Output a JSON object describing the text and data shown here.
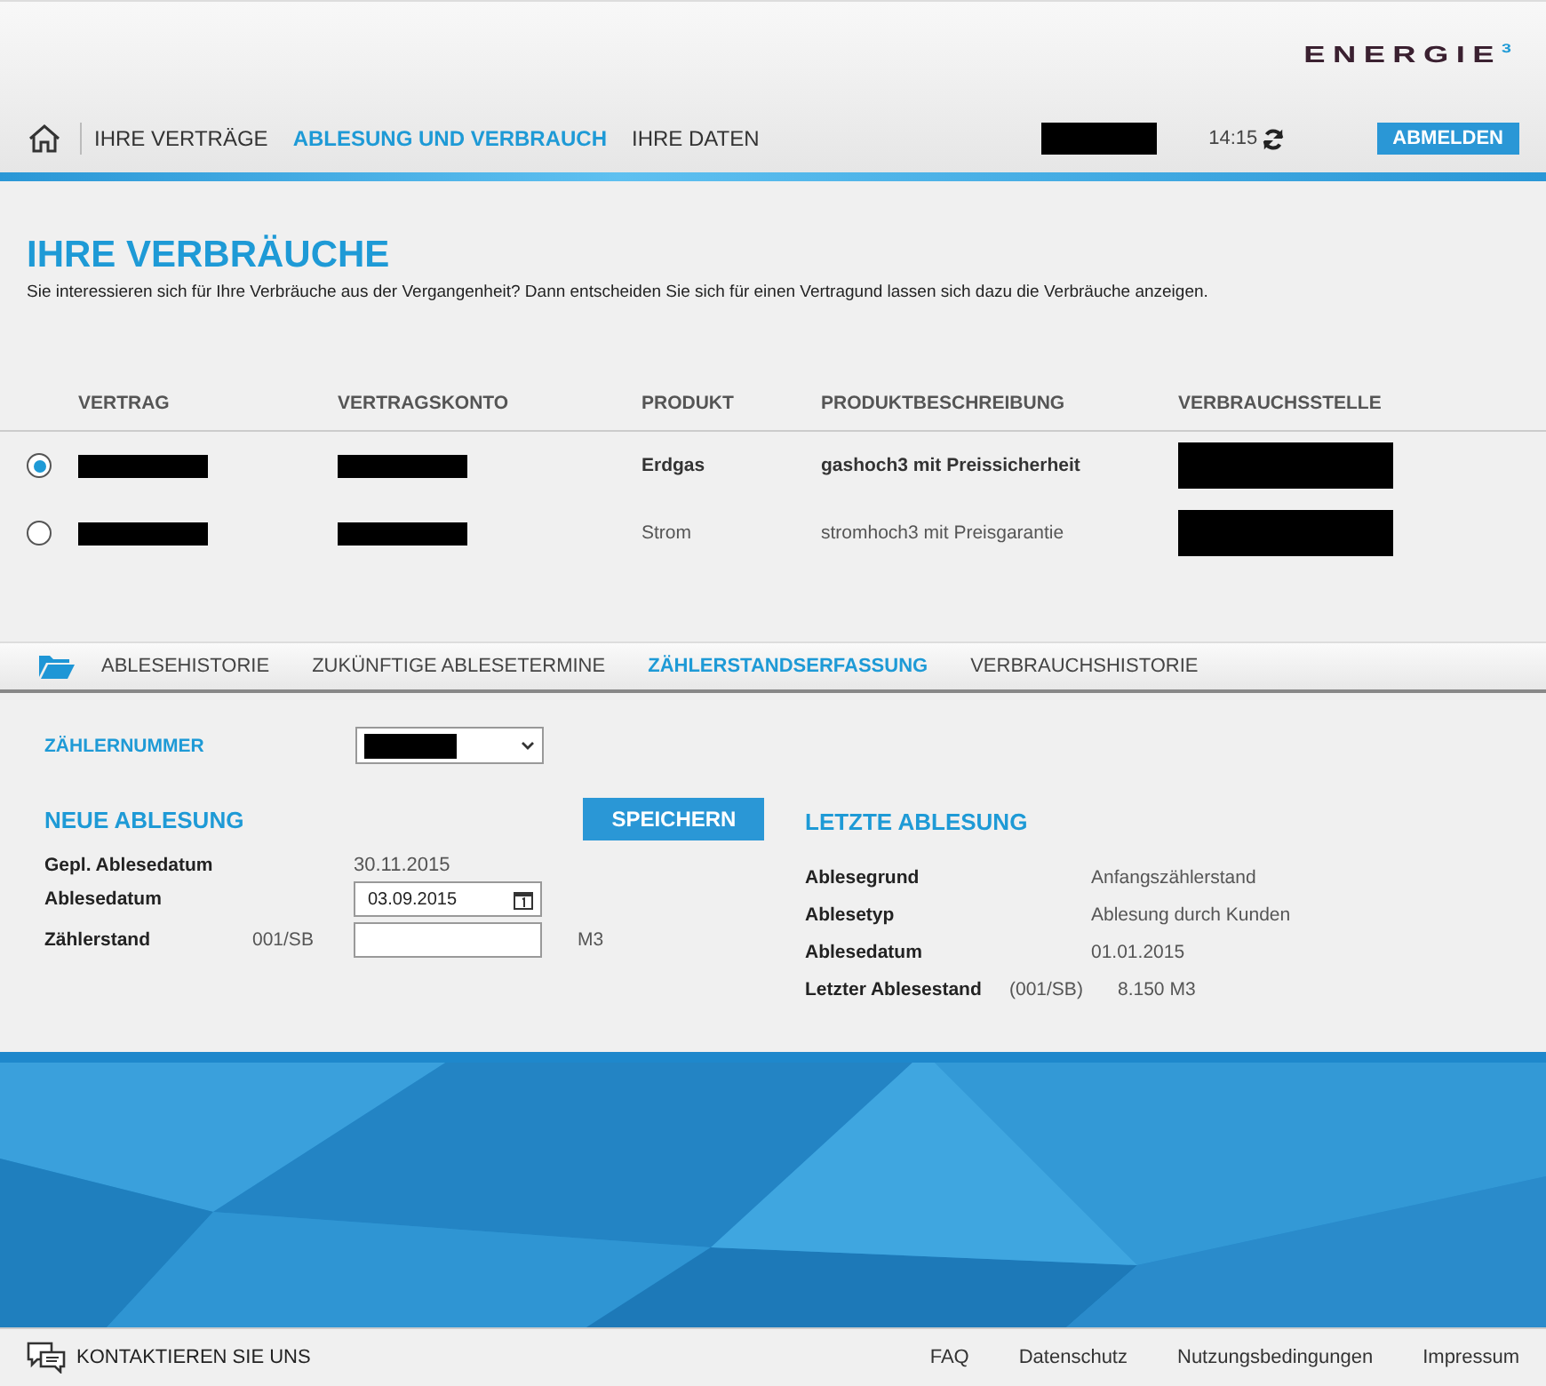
{
  "header": {
    "logo": "ENERGIE",
    "logo_sup": "3"
  },
  "nav": {
    "items": [
      {
        "label": "IHRE VERTRÄGE",
        "selected": false
      },
      {
        "label": "ABLESUNG UND VERBRAUCH",
        "selected": true
      },
      {
        "label": "IHRE DATEN",
        "selected": false
      }
    ],
    "time": "14:15",
    "logout": "ABMELDEN"
  },
  "intro": {
    "title": "IHRE VERBRÄUCHE",
    "text": "Sie interessieren sich für Ihre Verbräuche aus der Vergangenheit? Dann entscheiden Sie sich für einen Vertragund lassen sich dazu die Verbräuche anzeigen."
  },
  "contracts": {
    "columns": [
      "VERTRAG",
      "VERTRAGSKONTO",
      "PRODUKT",
      "PRODUKTBESCHREIBUNG",
      "VERBRAUCHSSTELLE"
    ],
    "rows": [
      {
        "selected": true,
        "produkt": "Erdgas",
        "beschreibung": "gashoch3 mit Preissicherheit"
      },
      {
        "selected": false,
        "produkt": "Strom",
        "beschreibung": "stromhoch3 mit Preisgarantie"
      }
    ]
  },
  "tabs": [
    {
      "label": "ABLESEHISTORIE",
      "selected": false
    },
    {
      "label": "ZUKÜNFTIGE ABLESETERMINE",
      "selected": false
    },
    {
      "label": "ZÄHLERSTANDSERFASSUNG",
      "selected": true
    },
    {
      "label": "VERBRAUCHSHISTORIE",
      "selected": false
    }
  ],
  "meter": {
    "label": "ZÄHLERNUMMER"
  },
  "new_reading": {
    "title": "NEUE ABLESUNG",
    "save": "SPEICHERN",
    "planned_label": "Gepl. Ablesedatum",
    "planned_value": "30.11.2015",
    "date_label": "Ablesedatum",
    "date_value": "03.09.2015",
    "reading_label": "Zählerstand",
    "reading_code": "001/SB",
    "unit": "M3"
  },
  "last_reading": {
    "title": "LETZTE ABLESUNG",
    "rows": [
      {
        "label": "Ablesegrund",
        "value": "Anfangszählerstand"
      },
      {
        "label": "Ablesetyp",
        "value": "Ablesung durch Kunden"
      },
      {
        "label": "Ablesedatum",
        "value": "01.01.2015"
      },
      {
        "label": "Letzter Ablesestand",
        "code": "(001/SB)",
        "value": "8.150 M3"
      }
    ]
  },
  "footer": {
    "contact": "KONTAKTIEREN SIE UNS",
    "links": [
      "FAQ",
      "Datenschutz",
      "Nutzungsbedingungen",
      "Impressum"
    ]
  }
}
